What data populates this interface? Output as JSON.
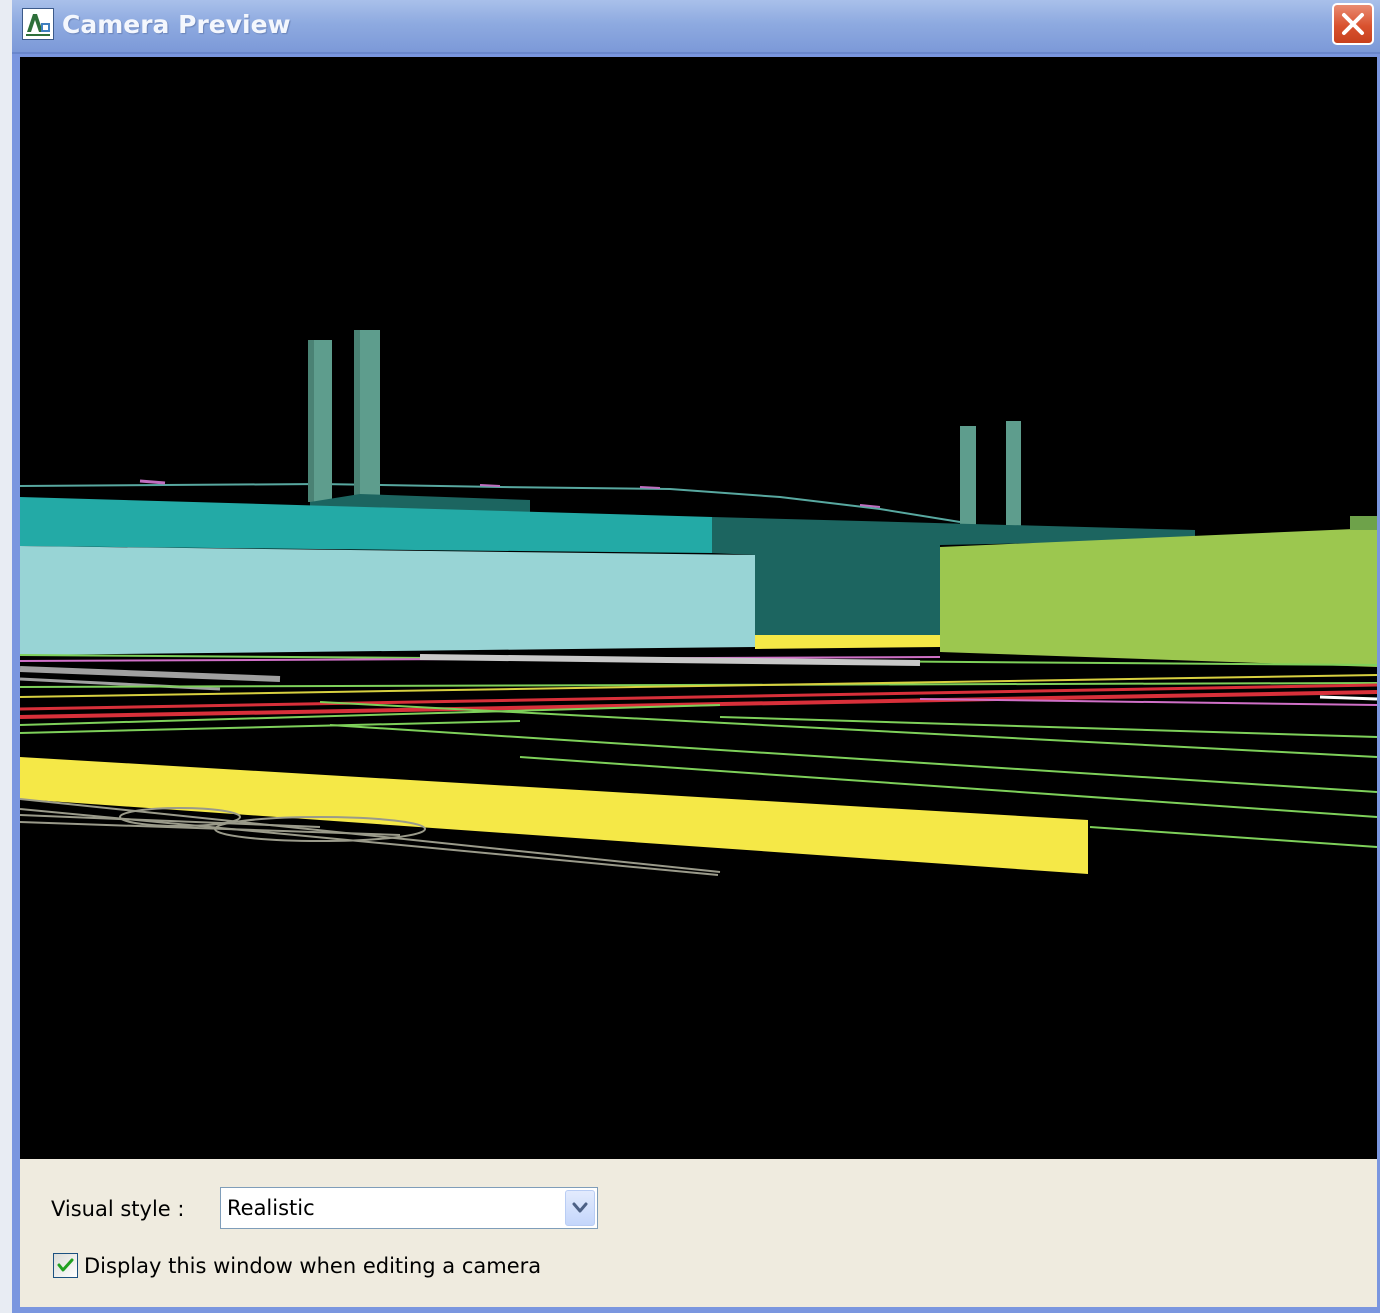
{
  "window": {
    "title": "Camera Preview",
    "app_icon": "autocad-app-icon",
    "close_icon": "close-icon",
    "title_gradient": [
      "#a9c0ea",
      "#7c99d8"
    ],
    "close_color": "#d9522f"
  },
  "viewport": {
    "background": "#000000",
    "scene_colors": {
      "teal_wall": "#23aaa6",
      "light_cyan_block": "#98d4d5",
      "dark_teal_block": "#1c6560",
      "green_block": "#9cc74f",
      "yellow_band": "#f5e847",
      "stacks": "#5e9d8d",
      "red_lines": "#d8303a",
      "green_lines": "#7ed05a",
      "magenta_lines": "#d070c8",
      "gray_lines": "#a0a0a0"
    }
  },
  "controls": {
    "visual_style_label": "Visual style :",
    "visual_style_value": "Realistic",
    "dropdown_icon": "chevron-down-icon",
    "display_checkbox_label": "Display this window when editing a camera",
    "display_checkbox_checked": true,
    "panel_color": "#efebdf"
  }
}
